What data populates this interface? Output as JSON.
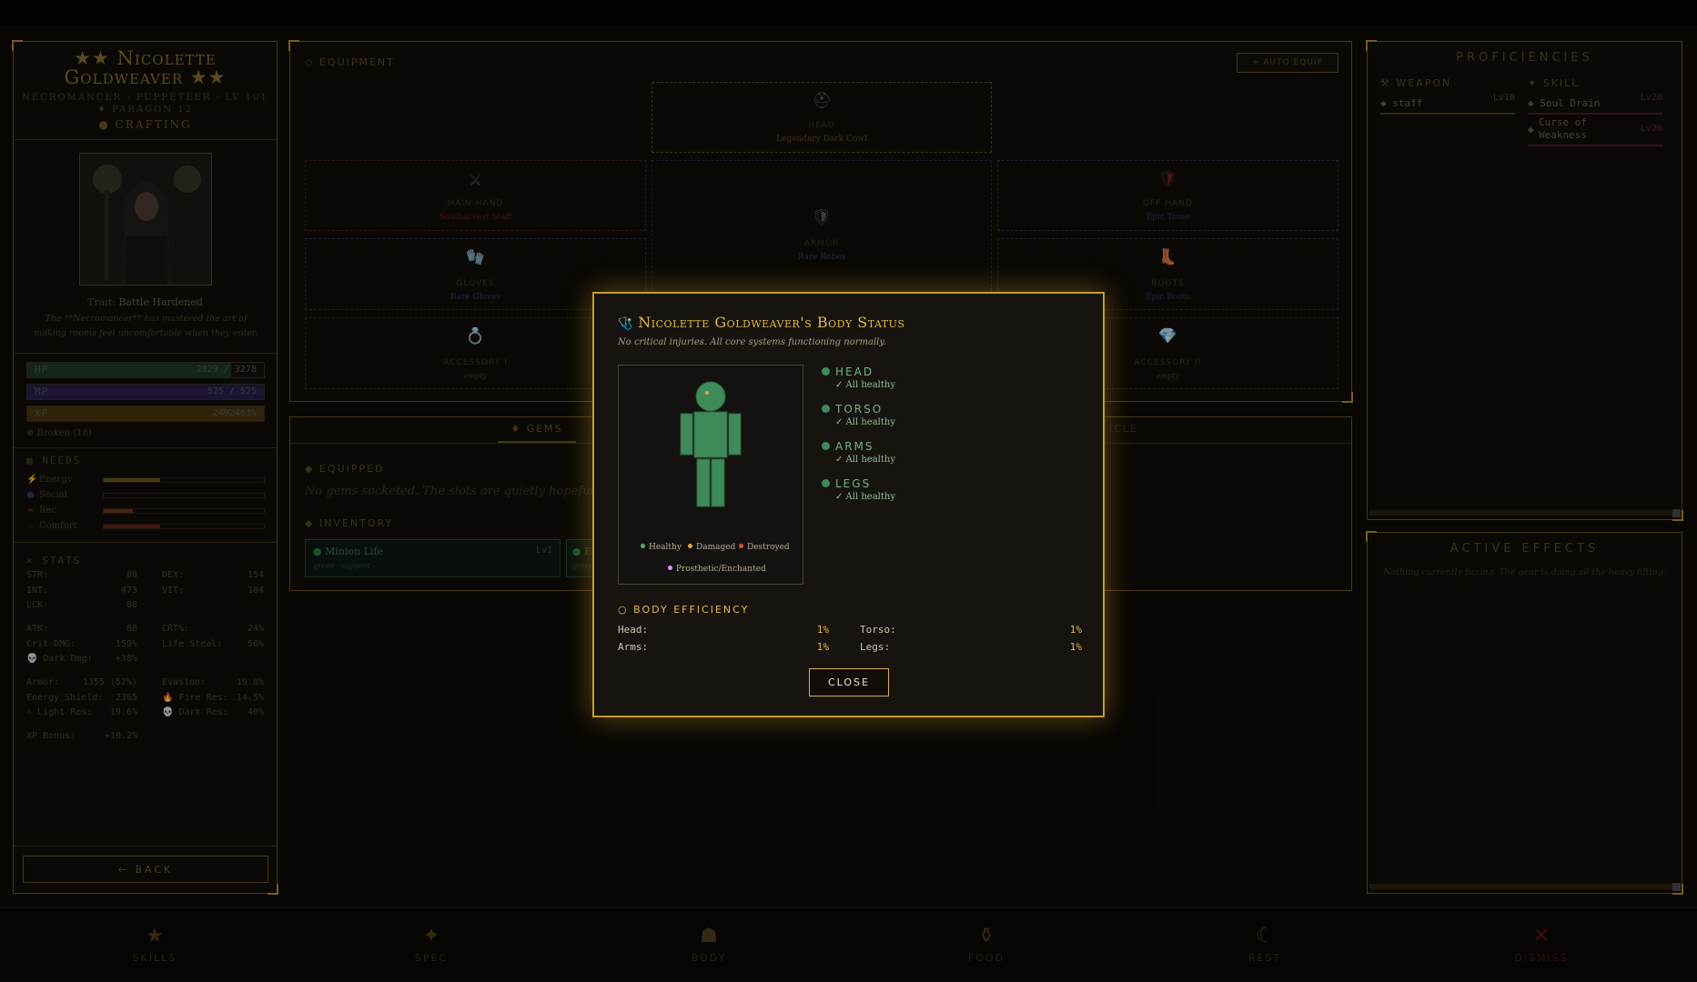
{
  "character": {
    "name_line1": "★★ Nicolette",
    "name_line2": "Goldweaver ★★",
    "class_line": "NECROMANCER · PUPPETEER · LV 101",
    "paragon": "♦ PARAGON 12",
    "crafting": "● CRAFTING",
    "trait_label": "Trait:",
    "trait_value": "Battle Hardened",
    "trait_desc": "The **Necromancer** has mastered the art of making rooms feel uncomfortable when they enter.",
    "hp": {
      "label": "HP",
      "value": "2829 / 3278",
      "fraction": 0.86
    },
    "mp": {
      "label": "MP",
      "value": "525 / 525",
      "fraction": 1.0
    },
    "xp": {
      "label": "XP",
      "value": "2492463%",
      "fraction": 1.0
    },
    "broken": "⊗ Broken (18)"
  },
  "needs": {
    "title": "NEEDS",
    "items": [
      {
        "icon": "⚡",
        "label": "Energy",
        "fraction": 0.35,
        "color": "#6b5a1c"
      },
      {
        "icon": "●",
        "label": "Social",
        "fraction": 0.0,
        "color": "#2a3a6b"
      },
      {
        "icon": "≈",
        "label": "Rec",
        "fraction": 0.18,
        "color": "#6a3a1a"
      },
      {
        "icon": "♨",
        "label": "Comfort",
        "fraction": 0.35,
        "color": "#6b1f1f"
      }
    ]
  },
  "stats": {
    "title": "STATS",
    "base": [
      {
        "k": "STR:",
        "v": "88"
      },
      {
        "k": "DEX:",
        "v": "154"
      },
      {
        "k": "INT:",
        "v": "473"
      },
      {
        "k": "VIT:",
        "v": "104"
      },
      {
        "k": "LCK:",
        "v": "88"
      }
    ],
    "combat": [
      {
        "k": "ATK:",
        "v": "88"
      },
      {
        "k": "CRT%:",
        "v": "24%"
      },
      {
        "k": "Crit DMG:",
        "v": "150%"
      },
      {
        "k": "Life Steal:",
        "v": "56%"
      },
      {
        "k": "💀 Dark Dmg:",
        "v": "+38%"
      }
    ],
    "defense": [
      {
        "k": "Armor:",
        "v": "1355 (52%)"
      },
      {
        "k": "Evasion:",
        "v": "19.8%"
      },
      {
        "k": "Energy Shield:",
        "v": "2365"
      },
      {
        "k": "🔥 Fire Res:",
        "v": "14.5%"
      },
      {
        "k": "✧ Light Res:",
        "v": "19.6%"
      },
      {
        "k": "💀 Dark Res:",
        "v": "40%"
      }
    ],
    "xp_bonus": {
      "k": "XP Bonus:",
      "v": "+10.2%"
    }
  },
  "back_button": "← BACK",
  "equipment": {
    "title": "◇ EQUIPMENT",
    "auto_equip": "+ AUTO EQUIP",
    "slots": {
      "head": {
        "name": "HEAD",
        "item": "Legendary Dark Cowl",
        "icon": "⛑"
      },
      "main_hand": {
        "name": "MAIN HAND",
        "item": "Soulharvest Staff",
        "icon": "⚔"
      },
      "armor": {
        "name": "ARMOR",
        "item": "Rare Robes",
        "icon": "🛡"
      },
      "off_hand": {
        "name": "OFF HAND",
        "item": "Epic Tome",
        "icon": "🛡"
      },
      "gloves": {
        "name": "GLOVES",
        "item": "Rare Gloves",
        "icon": "🧤"
      },
      "boots": {
        "name": "BOOTS",
        "item": "Epic Boots",
        "icon": "👢"
      },
      "accessory1": {
        "name": "ACCESSORY I",
        "item": "empty",
        "icon": "💍"
      },
      "accessory2": {
        "name": "ACCESSORY II",
        "item": "empty",
        "icon": "💎"
      }
    }
  },
  "gems": {
    "tab_gems": "♦ GEMS",
    "tab_other": "ICLE",
    "equipped_title": "◆ EQUIPPED",
    "equipped_empty": "No gems socketed. The slots are quietly hopeful.",
    "inventory_title": "◆ INVENTORY",
    "inventory": [
      {
        "name": "Minion Life",
        "level": "Lv1",
        "tag": "green · support"
      },
      {
        "name": "En",
        "level": "",
        "tag": "green"
      }
    ]
  },
  "proficiencies": {
    "title": "PROFICIENCIES",
    "weapon_title": "⚒ WEAPON",
    "skill_title": "✦ SKILL",
    "weapons": [
      {
        "name": "staff",
        "level": "Lv10"
      }
    ],
    "skills": [
      {
        "name": "Soul Drain",
        "level": "Lv20"
      },
      {
        "name": "Curse of Weakness",
        "level": "Lv20"
      }
    ]
  },
  "effects": {
    "title": "ACTIVE EFFECTS",
    "empty": "Nothing currently fizzing. The gear is doing all the heavy lifting."
  },
  "nav": [
    {
      "label": "SKILLS",
      "icon": "★"
    },
    {
      "label": "SPEC",
      "icon": "✦"
    },
    {
      "label": "BODY",
      "icon": "☗"
    },
    {
      "label": "FOOD",
      "icon": "⚱"
    },
    {
      "label": "REST",
      "icon": "☾"
    },
    {
      "label": "DISMISS",
      "icon": "✕"
    }
  ],
  "modal": {
    "title_icon": "🩺",
    "title": "Nicolette Goldweaver's Body Status",
    "status": "No critical injuries. All core systems functioning normally.",
    "legend": [
      {
        "label": "Healthy",
        "color": "#4caf6a"
      },
      {
        "label": "Damaged",
        "color": "#e2a63a"
      },
      {
        "label": "Destroyed",
        "color": "#d9503a"
      },
      {
        "label": "Prosthetic/Enchanted",
        "color": "#d0a0ff"
      }
    ],
    "parts": [
      {
        "name": "HEAD",
        "status": "✓ All healthy"
      },
      {
        "name": "TORSO",
        "status": "✓ All healthy"
      },
      {
        "name": "ARMS",
        "status": "✓ All healthy"
      },
      {
        "name": "LEGS",
        "status": "✓ All healthy"
      }
    ],
    "efficiency_title": "○ BODY EFFICIENCY",
    "efficiency": [
      {
        "k": "Head:",
        "v": "1%"
      },
      {
        "k": "Torso:",
        "v": "1%"
      },
      {
        "k": "Arms:",
        "v": "1%"
      },
      {
        "k": "Legs:",
        "v": "1%"
      }
    ],
    "close": "CLOSE",
    "colors": {
      "healthy": "#3f8a59",
      "accent": "#e2b94a"
    }
  }
}
